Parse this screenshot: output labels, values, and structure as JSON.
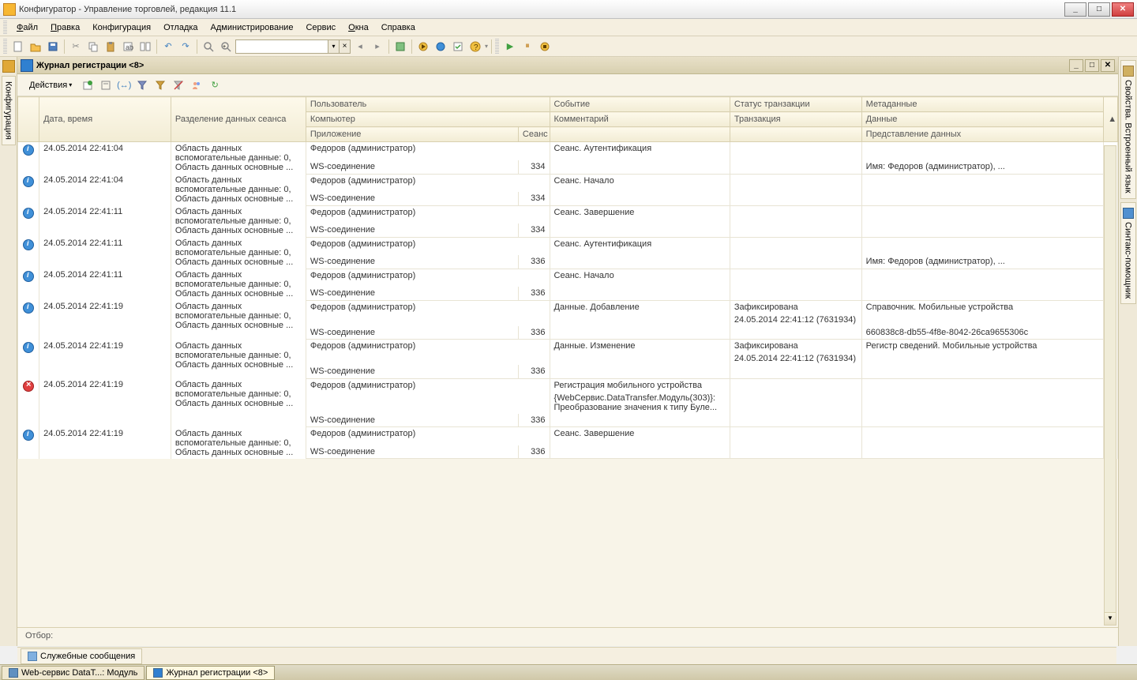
{
  "window": {
    "title": "Конфигуратор - Управление торговлей, редакция 11.1"
  },
  "menu": {
    "file": "Файл",
    "edit": "Правка",
    "config": "Конфигурация",
    "debug": "Отладка",
    "admin": "Администрирование",
    "service": "Сервис",
    "windows": "Окна",
    "help": "Справка"
  },
  "inner_window": {
    "title": "Журнал регистрации <8>"
  },
  "actions": {
    "label": "Действия"
  },
  "left_rail": {
    "config": "Конфигурация"
  },
  "right_rail": {
    "properties": "Свойства. Встроенный язык",
    "syntax": "Синтакс-помощник"
  },
  "grid": {
    "headers": {
      "datetime": "Дата, время",
      "data_separation": "Разделение данных сеанса",
      "user": "Пользователь",
      "event": "Событие",
      "trans_status": "Статус транзакции",
      "metadata": "Метаданные",
      "computer": "Компьютер",
      "comment": "Комментарий",
      "transaction": "Транзакция",
      "data": "Данные",
      "application": "Приложение",
      "session": "Сеанс",
      "representation": "Представление данных"
    },
    "rows": [
      {
        "icon": "info",
        "datetime": "24.05.2014 22:41:04",
        "sep": "Область данных вспомогательные данные: 0, Область данных основные ...",
        "user": "Федоров (администратор)",
        "app": "WS-соединение",
        "session": "334",
        "event": "Сеанс. Аутентификация",
        "comment": "",
        "trans_status": "",
        "transaction": "",
        "metadata": "",
        "data": "",
        "repr": "Имя: Федоров (администратор), ..."
      },
      {
        "icon": "info",
        "datetime": "24.05.2014 22:41:04",
        "sep": "Область данных вспомогательные данные: 0, Область данных основные ...",
        "user": "Федоров (администратор)",
        "app": "WS-соединение",
        "session": "334",
        "event": "Сеанс. Начало",
        "comment": "",
        "trans_status": "",
        "transaction": "",
        "metadata": "",
        "data": "",
        "repr": ""
      },
      {
        "icon": "info",
        "datetime": "24.05.2014 22:41:11",
        "sep": "Область данных вспомогательные данные: 0, Область данных основные ...",
        "user": "Федоров (администратор)",
        "app": "WS-соединение",
        "session": "334",
        "event": "Сеанс. Завершение",
        "comment": "",
        "trans_status": "",
        "transaction": "",
        "metadata": "",
        "data": "",
        "repr": ""
      },
      {
        "icon": "info",
        "datetime": "24.05.2014 22:41:11",
        "sep": "Область данных вспомогательные данные: 0, Область данных основные ...",
        "user": "Федоров (администратор)",
        "app": "WS-соединение",
        "session": "336",
        "event": "Сеанс. Аутентификация",
        "comment": "",
        "trans_status": "",
        "transaction": "",
        "metadata": "",
        "data": "",
        "repr": "Имя: Федоров (администратор), ..."
      },
      {
        "icon": "info",
        "datetime": "24.05.2014 22:41:11",
        "sep": "Область данных вспомогательные данные: 0, Область данных основные ...",
        "user": "Федоров (администратор)",
        "app": "WS-соединение",
        "session": "336",
        "event": "Сеанс. Начало",
        "comment": "",
        "trans_status": "",
        "transaction": "",
        "metadata": "",
        "data": "",
        "repr": ""
      },
      {
        "icon": "info",
        "datetime": "24.05.2014 22:41:19",
        "sep": "Область данных вспомогательные данные: 0, Область данных основные ...",
        "user": "Федоров (администратор)",
        "app": "WS-соединение",
        "session": "336",
        "event": "Данные. Добавление",
        "comment": "",
        "trans_status": "Зафиксирована",
        "transaction": "24.05.2014 22:41:12 (7631934)",
        "metadata": "Справочник. Мобильные устройства",
        "data": "",
        "repr": "660838c8-db55-4f8e-8042-26ca9655306c"
      },
      {
        "icon": "info",
        "datetime": "24.05.2014 22:41:19",
        "sep": "Область данных вспомогательные данные: 0, Область данных основные ...",
        "user": "Федоров (администратор)",
        "app": "WS-соединение",
        "session": "336",
        "event": "Данные. Изменение",
        "comment": "",
        "trans_status": "Зафиксирована",
        "transaction": "24.05.2014 22:41:12 (7631934)",
        "metadata": "Регистр сведений. Мобильные устройства",
        "data": "",
        "repr": ""
      },
      {
        "icon": "error",
        "datetime": "24.05.2014 22:41:19",
        "sep": "Область данных вспомогательные данные: 0, Область данных основные ...",
        "user": "Федоров (администратор)",
        "app": "WS-соединение",
        "session": "336",
        "event": "Регистрация мобильного устройства",
        "comment": "{WebСервис.DataTransfer.Модуль(303)}: Преобразование значения к типу Буле...",
        "trans_status": "",
        "transaction": "",
        "metadata": "",
        "data": "",
        "repr": ""
      },
      {
        "icon": "info",
        "datetime": "24.05.2014 22:41:19",
        "sep": "Область данных вспомогательные данные: 0, Область данных основные ...",
        "user": "Федоров (администратор)",
        "app": "WS-соединение",
        "session": "336",
        "event": "Сеанс. Завершение",
        "comment": "",
        "trans_status": "",
        "transaction": "",
        "metadata": "",
        "data": "",
        "repr": ""
      }
    ]
  },
  "filter": {
    "label": "Отбор:"
  },
  "bottom_panel": {
    "messages": "Служебные сообщения"
  },
  "taskbar": {
    "item1": "Web-сервис DataT...: Модуль",
    "item2": "Журнал регистрации <8>"
  }
}
